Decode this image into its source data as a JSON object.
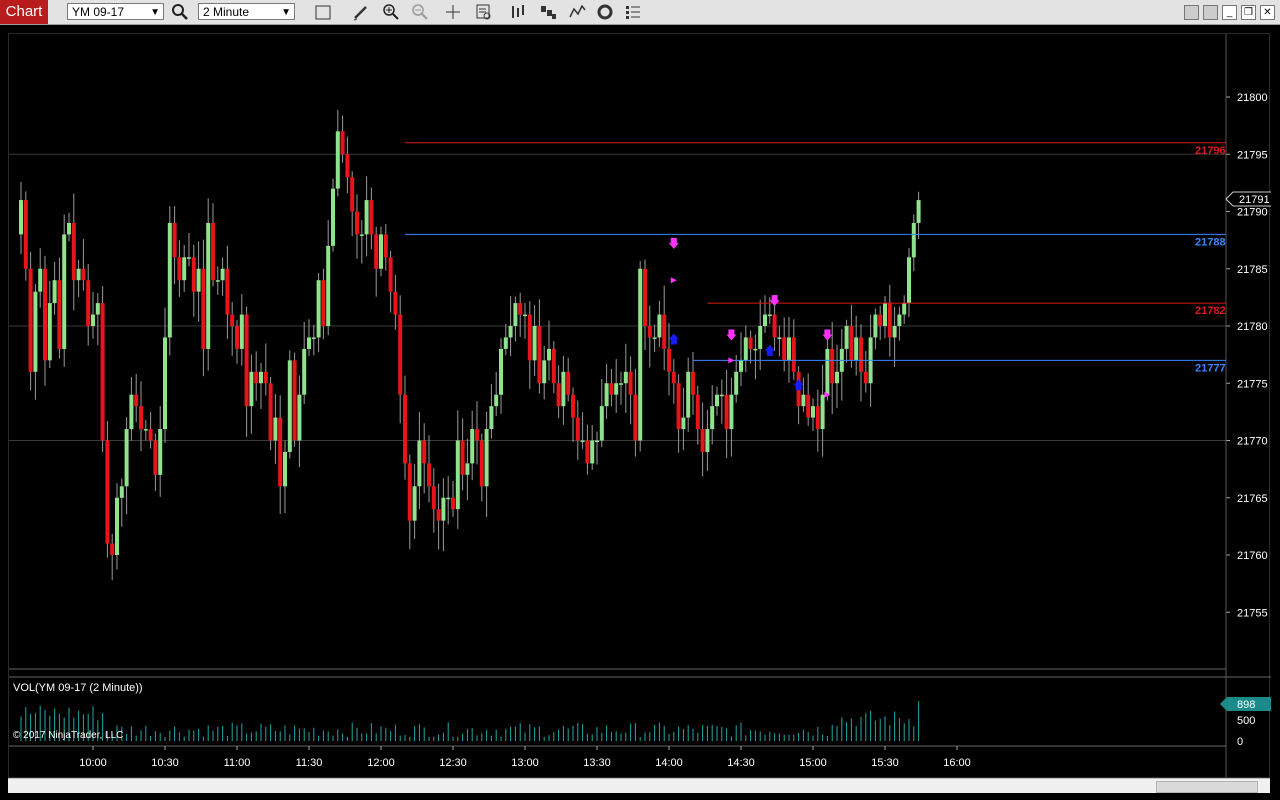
{
  "toolbar": {
    "tab_label": "Chart",
    "instrument": "YM 09-17",
    "interval": "2 Minute",
    "icons": [
      "search-icon",
      "draw-pencil-icon",
      "zoom-in-icon",
      "zoom-out-icon",
      "crosshair-icon",
      "data-box-icon",
      "bar-type-icon",
      "chart-style-icon",
      "indicators-icon",
      "strategies-icon",
      "properties-icon"
    ]
  },
  "window_buttons": {
    "minimize": "_",
    "restore": "❐",
    "close": "✕"
  },
  "price_axis": {
    "labels": [
      "21800",
      "21795",
      "21790",
      "21785",
      "21780",
      "21775",
      "21770",
      "21765",
      "21760",
      "21755"
    ],
    "current_price": "21791"
  },
  "lines": [
    {
      "price": 21796,
      "label": "21796",
      "color": "#e01818",
      "start": "12:10"
    },
    {
      "price": 21788,
      "label": "21788",
      "color": "#3a86ff",
      "start": "12:10"
    },
    {
      "price": 21782,
      "label": "21782",
      "color": "#e01818",
      "start": "14:16"
    },
    {
      "price": 21777,
      "label": "21777",
      "color": "#3a86ff",
      "start": "14:10"
    }
  ],
  "time_axis": {
    "labels": [
      "10:00",
      "10:30",
      "11:00",
      "11:30",
      "12:00",
      "12:30",
      "13:00",
      "13:30",
      "14:00",
      "14:30",
      "15:00",
      "15:30",
      "16:00"
    ]
  },
  "volume_panel": {
    "title": "VOL(YM 09-17 (2 Minute))",
    "labels": [
      "500",
      "0"
    ],
    "current": "898"
  },
  "copyright": "© 2017 NinjaTrader, LLC",
  "colors": {
    "up": "#8fe38c",
    "down": "#e8141a",
    "grid": "#3a3a3a",
    "volume": "#1fa7a7",
    "arrow_magenta": "#ff33ff",
    "arrow_blue": "#1a1aff",
    "badge": "#1b8a8a"
  },
  "chart_data": {
    "type": "candlestick",
    "x": [
      "09:30",
      "09:32",
      "09:34",
      "09:36",
      "09:38",
      "09:40",
      "09:42",
      "09:44",
      "09:46",
      "09:48",
      "09:50",
      "09:52",
      "09:54",
      "09:56",
      "09:58",
      "10:00",
      "10:02",
      "10:04",
      "10:06",
      "10:08",
      "10:10",
      "10:12",
      "10:14",
      "10:16",
      "10:18",
      "10:20",
      "10:22",
      "10:24",
      "10:26",
      "10:28",
      "10:30",
      "10:32",
      "10:34",
      "10:36",
      "10:38",
      "10:40",
      "10:42",
      "10:44",
      "10:46",
      "10:48",
      "10:50",
      "10:52",
      "10:54",
      "10:56",
      "10:58",
      "11:00",
      "11:02",
      "11:04",
      "11:06",
      "11:08",
      "11:10",
      "11:12",
      "11:14",
      "11:16",
      "11:18",
      "11:20",
      "11:22",
      "11:24",
      "11:26",
      "11:28",
      "11:30",
      "11:32",
      "11:34",
      "11:36",
      "11:38",
      "11:40",
      "11:42",
      "11:44",
      "11:46",
      "11:48",
      "11:50",
      "11:52",
      "11:54",
      "11:56",
      "11:58",
      "12:00",
      "12:02",
      "12:04",
      "12:06",
      "12:08",
      "12:10",
      "12:12",
      "12:14",
      "12:16",
      "12:18",
      "12:20",
      "12:22",
      "12:24",
      "12:26",
      "12:28",
      "12:30",
      "12:32",
      "12:34",
      "12:36",
      "12:38",
      "12:40",
      "12:42",
      "12:44",
      "12:46",
      "12:48",
      "12:50",
      "12:52",
      "12:54",
      "12:56",
      "12:58",
      "13:00",
      "13:02",
      "13:04",
      "13:06",
      "13:08",
      "13:10",
      "13:12",
      "13:14",
      "13:16",
      "13:18",
      "13:20",
      "13:22",
      "13:24",
      "13:26",
      "13:28",
      "13:30",
      "13:32",
      "13:34",
      "13:36",
      "13:38",
      "13:40",
      "13:42",
      "13:44",
      "13:46",
      "13:48",
      "13:50",
      "13:52",
      "13:54",
      "13:56",
      "13:58",
      "14:00",
      "14:02",
      "14:04",
      "14:06",
      "14:08",
      "14:10",
      "14:12",
      "14:14",
      "14:16",
      "14:18",
      "14:20",
      "14:22",
      "14:24",
      "14:26",
      "14:28",
      "14:30",
      "14:32",
      "14:34",
      "14:36",
      "14:38",
      "14:40",
      "14:42",
      "14:44",
      "14:46",
      "14:48",
      "14:50",
      "14:52",
      "14:54",
      "14:56",
      "14:58",
      "15:00",
      "15:02",
      "15:04",
      "15:06",
      "15:08",
      "15:10",
      "15:12",
      "15:14",
      "15:16",
      "15:18",
      "15:20",
      "15:22",
      "15:24",
      "15:26",
      "15:28",
      "15:30",
      "15:32",
      "15:34",
      "15:36",
      "15:38",
      "15:40",
      "15:42",
      "15:44",
      "15:46",
      "15:48",
      "15:50",
      "15:52",
      "15:54",
      "15:56",
      "15:58",
      "16:00"
    ],
    "close": [
      21791,
      21785,
      21776,
      21783,
      21785,
      21777,
      21782,
      21784,
      21778,
      21788,
      21789,
      21784,
      21785,
      21784,
      21780,
      21781,
      21782,
      21770,
      21761,
      21760,
      21765,
      21766,
      21771,
      21774,
      21773,
      21771,
      21771,
      21770,
      21767,
      21771,
      21779,
      21789,
      21786,
      21784,
      21786,
      21786,
      21783,
      21785,
      21778,
      21789,
      21784,
      21784,
      21785,
      21781,
      21780,
      21778,
      21781,
      21773,
      21776,
      21775,
      21776,
      21775,
      21770,
      21772,
      21766,
      21769,
      21777,
      21770,
      21774,
      21778,
      21779,
      21779,
      21784,
      21780,
      21787,
      21792,
      21797,
      21795,
      21793,
      21790,
      21788,
      21788,
      21791,
      21788,
      21785,
      21788,
      21786,
      21783,
      21781,
      21774,
      21768,
      21763,
      21766,
      21770,
      21768,
      21766,
      21764,
      21763,
      21765,
      21765,
      21764,
      21770,
      21767,
      21768,
      21771,
      21770,
      21766,
      21771,
      21773,
      21774,
      21778,
      21779,
      21780,
      21782,
      21781,
      21781,
      21777,
      21780,
      21775,
      21777,
      21778,
      21775,
      21773,
      21776,
      21774,
      21772,
      21770,
      21770,
      21768,
      21770,
      21770,
      21773,
      21775,
      21774,
      21775,
      21775,
      21776,
      21774,
      21770,
      21785,
      21780,
      21779,
      21779,
      21781,
      21778,
      21776,
      21775,
      21771,
      21772,
      21776,
      21774,
      21771,
      21769,
      21771,
      21773,
      21774,
      21774,
      21771,
      21774,
      21776,
      21777,
      21779,
      21778,
      21778,
      21780,
      21781,
      21781,
      21779,
      21779,
      21777,
      21779,
      21776,
      21773,
      21774,
      21772,
      21773,
      21771,
      21774,
      21778,
      21775,
      21776,
      21778,
      21780,
      21777,
      21779,
      21776,
      21775,
      21779,
      21781,
      21780,
      21782,
      21779,
      21780,
      21781,
      21782,
      21786,
      21789,
      21791
    ],
    "ylim": [
      21750,
      21805
    ],
    "volume": {
      "max": 900,
      "current": 898
    }
  }
}
